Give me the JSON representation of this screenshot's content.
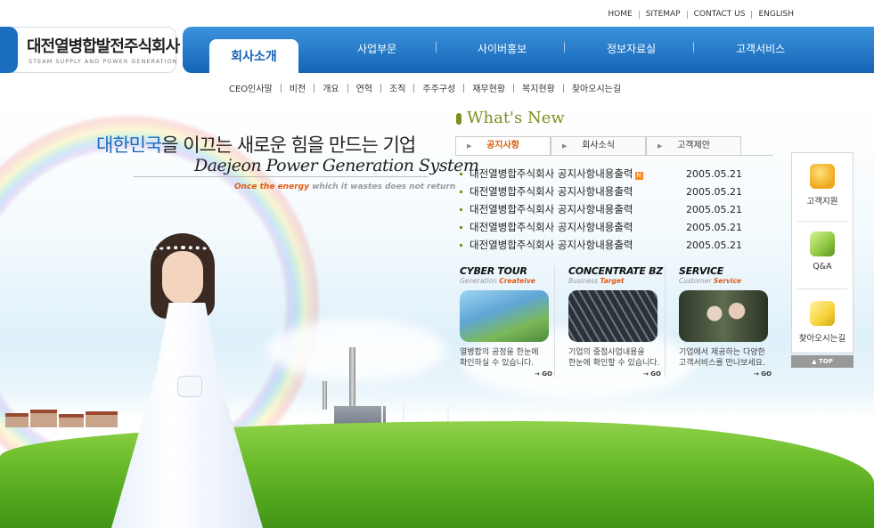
{
  "header": {
    "logo_kr": "대전열병합발전주식회사",
    "logo_en": "STEAM SUPPLY AND POWER GENERATION",
    "top_links": [
      "HOME",
      "SITEMAP",
      "CONTACT US",
      "ENGLISH"
    ],
    "active_menu": "회사소개",
    "menu": [
      "사업부문",
      "사이버홍보",
      "정보자료실",
      "고객서비스"
    ],
    "submenu": [
      "CEO인사말",
      "비전",
      "개요",
      "연혁",
      "조직",
      "주주구성",
      "재무현황",
      "복지현황",
      "찾아오시는길"
    ]
  },
  "hero": {
    "slogan_kr_highlight": "대한민국",
    "slogan_kr_rest": "을 이끄는 새로운 힘을 만드는 기업",
    "slogan_en": "Daejeon Power Generation System",
    "tagline_highlight": "Once the energy",
    "tagline_rest": "which it wastes does not return"
  },
  "whats_new": {
    "title": "What's New",
    "tabs": [
      "공지사항",
      "회사소식",
      "고객제안"
    ],
    "items": [
      {
        "title": "대전열병합주식회사 공지사항내용출력",
        "date": "2005.05.21",
        "new_badge": "N"
      },
      {
        "title": "대전열병합주식회사 공지사항내용출력",
        "date": "2005.05.21"
      },
      {
        "title": "대전열병합주식회사 공지사항내용출력",
        "date": "2005.05.21"
      },
      {
        "title": "대전열병합주식회사 공지사항내용출력",
        "date": "2005.05.21"
      },
      {
        "title": "대전열병합주식회사 공지사항내용출력",
        "date": "2005.05.21"
      }
    ]
  },
  "features": [
    {
      "title": "CYBER TOUR",
      "sub1": "Generation",
      "sub2": "Createive",
      "desc1": "열병합의 공정을 한눈에",
      "desc2": "확인하실 수 있습니다.",
      "go": "→ GO"
    },
    {
      "title": "CONCENTRATE BZ",
      "sub1": "Business",
      "sub2": "Target",
      "desc1": "기업의 중점사업내용을",
      "desc2": "한눈에 확인할 수 있습니다.",
      "go": "→ GO"
    },
    {
      "title": "SERVICE",
      "sub1": "Customer",
      "sub2": "Service",
      "desc1": "기업에서 제공하는 다양한",
      "desc2": "고객서비스를 만나보세요.",
      "go": "→ GO"
    }
  ],
  "quick_menu": {
    "items": [
      "고객지원",
      "Q&A",
      "찾아오시는길"
    ],
    "top": "▲ TOP"
  },
  "colors": {
    "brand_blue": "#1565b6",
    "accent_orange": "#e05a14",
    "olive": "#7c8f1f"
  }
}
